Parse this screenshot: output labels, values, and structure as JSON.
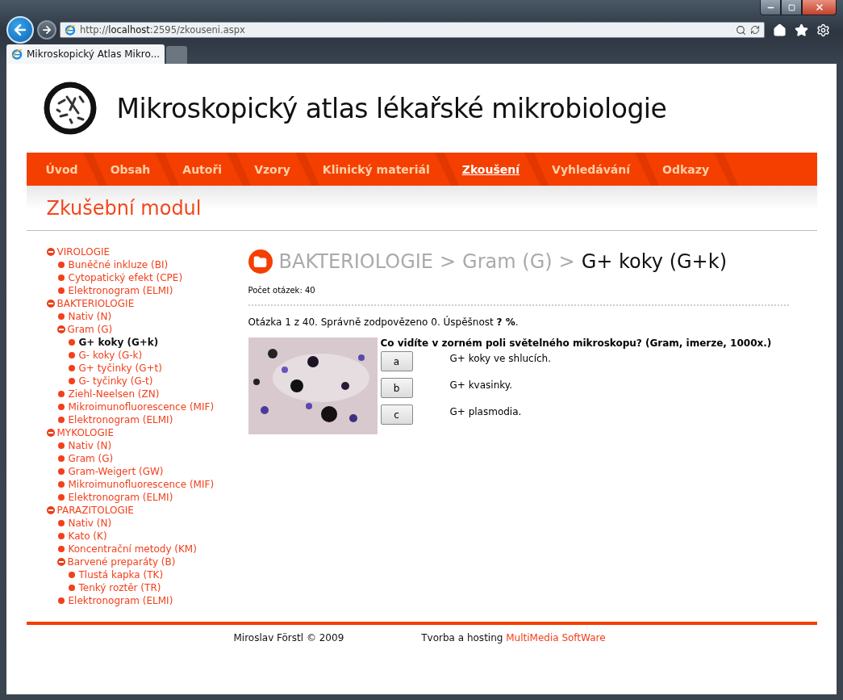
{
  "browser": {
    "address": "http://**localhost**:2595/zkouseni.aspx",
    "tab_title": "Mikroskopický Atlas Mikro..."
  },
  "site_title": "Mikroskopický atlas lékařské mikrobiologie",
  "nav": [
    {
      "label": "Úvod",
      "selected": false
    },
    {
      "label": "Obsah",
      "selected": false
    },
    {
      "label": "Autoři",
      "selected": false
    },
    {
      "label": "Vzory",
      "selected": false
    },
    {
      "label": "Klinický materiál",
      "selected": false
    },
    {
      "label": "Zkoušení",
      "selected": true
    },
    {
      "label": "Vyhledávání",
      "selected": false
    },
    {
      "label": "Odkazy",
      "selected": false
    }
  ],
  "section_title": "Zkušební modul",
  "tree": [
    {
      "label": "VIROLOGIE",
      "expanded": true,
      "selected": false,
      "children": [
        {
          "label": "Buněčné inkluze (BI)",
          "selected": false
        },
        {
          "label": "Cytopatický efekt (CPE)",
          "selected": false
        },
        {
          "label": "Elektronogram (ELMI)",
          "selected": false
        }
      ]
    },
    {
      "label": "BAKTERIOLOGIE",
      "expanded": true,
      "selected": false,
      "children": [
        {
          "label": "Nativ (N)",
          "selected": false
        },
        {
          "label": "Gram (G)",
          "expanded": true,
          "selected": false,
          "children": [
            {
              "label": "G+ koky (G+k)",
              "selected": true
            },
            {
              "label": "G- koky (G-k)",
              "selected": false
            },
            {
              "label": "G+ tyčinky (G+t)",
              "selected": false
            },
            {
              "label": "G- tyčinky (G-t)",
              "selected": false
            }
          ]
        },
        {
          "label": "Ziehl-Neelsen (ZN)",
          "selected": false
        },
        {
          "label": "Mikroimunofluorescence (MIF)",
          "selected": false
        },
        {
          "label": "Elektronogram (ELMI)",
          "selected": false
        }
      ]
    },
    {
      "label": "MYKOLOGIE",
      "expanded": true,
      "selected": false,
      "children": [
        {
          "label": "Nativ (N)",
          "selected": false
        },
        {
          "label": "Gram (G)",
          "selected": false
        },
        {
          "label": "Gram-Weigert (GW)",
          "selected": false
        },
        {
          "label": "Mikroimunofluorescence (MIF)",
          "selected": false
        },
        {
          "label": "Elektronogram (ELMI)",
          "selected": false
        }
      ]
    },
    {
      "label": "PARAZITOLOGIE",
      "expanded": true,
      "selected": false,
      "children": [
        {
          "label": "Nativ (N)",
          "selected": false
        },
        {
          "label": "Kato (K)",
          "selected": false
        },
        {
          "label": "Koncentrační metody (KM)",
          "selected": false
        },
        {
          "label": "Barvené preparáty (B)",
          "expanded": true,
          "selected": false,
          "children": [
            {
              "label": "Tlustá kapka (TK)",
              "selected": false
            },
            {
              "label": "Tenký roztěr (TR)",
              "selected": false
            }
          ]
        },
        {
          "label": "Elektronogram (ELMI)",
          "selected": false
        }
      ]
    }
  ],
  "breadcrumb": [
    {
      "label": "BAKTERIOLOGIE",
      "selected": false
    },
    {
      "separator": ">",
      "label": "Gram (G)",
      "selected": false
    },
    {
      "separator": ">",
      "label": "G+ koky (G+k)",
      "selected": true
    }
  ],
  "question_count": "Počet otázek: 40",
  "progress": "Otázka 1 z 40. Správně zodpovězeno 0. Úspěšnost **? %**.",
  "question": "Co vidíte v zorném poli světelného mikroskopu? (Gram, imerze, 1000x.)",
  "answers": [
    {
      "key": "a",
      "text": "G+ koky ve shlucích."
    },
    {
      "key": "b",
      "text": "G+ kvasinky."
    },
    {
      "key": "c",
      "text": "G+ plasmodia."
    }
  ],
  "footer": {
    "author": "Miroslav Förstl © 2009",
    "hosting": "Tvorba a hosting ",
    "hosting_link": "MultiMedia SoftWare"
  }
}
